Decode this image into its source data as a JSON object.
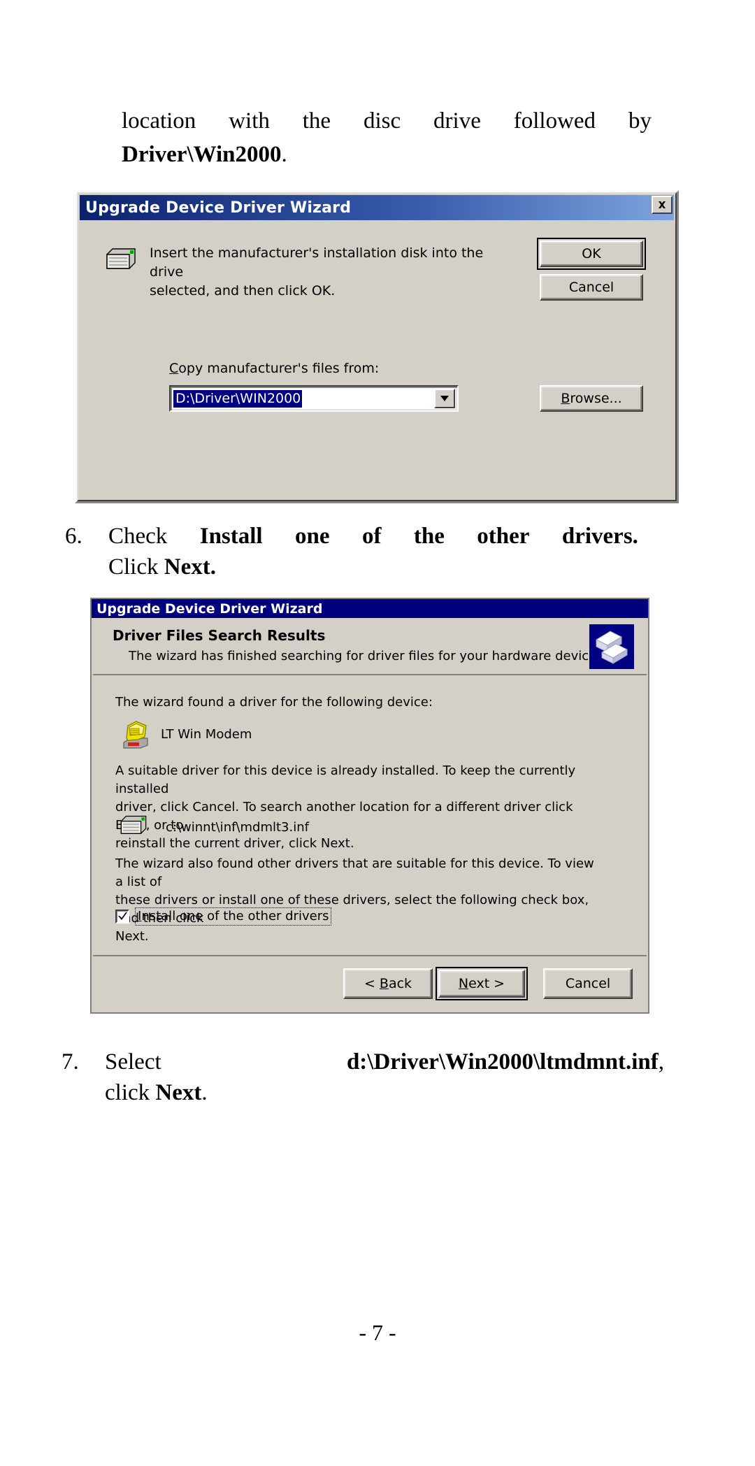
{
  "document": {
    "paragraph_continuation": {
      "line1_words": [
        "location",
        "with",
        "the",
        "disc",
        "drive",
        "followed",
        "by"
      ],
      "line2_bold": "Driver\\Win2000",
      "line2_period": "."
    },
    "step6": {
      "number": "6.",
      "line1_words": [
        "Check",
        "Install",
        "one",
        "of",
        "the",
        "other",
        "drivers."
      ],
      "line2_prefix": "Click ",
      "line2_bold": "Next."
    },
    "step7": {
      "number": "7.",
      "line1_prefix": "Select",
      "line1_bold": "d:\\Driver\\Win2000\\ltmdmnt.inf",
      "line1_suffix": ",",
      "line2_prefix": "click ",
      "line2_bold": "Next",
      "line2_suffix": "."
    },
    "page_number": "- 7 -"
  },
  "dialog1": {
    "title": "Upgrade Device Driver Wizard",
    "close_label": "✕",
    "message_line1": "Insert the manufacturer's installation disk into the drive",
    "message_line2": "selected, and then click OK.",
    "ok_label": "OK",
    "cancel_label": "Cancel",
    "copy_label_accesskey": "C",
    "copy_label_rest": "opy manufacturer's files from:",
    "path_value": "D:\\Driver\\WIN2000",
    "browse_accesskey": "B",
    "browse_rest": "rowse...",
    "icons": {
      "drive": "floppy-drive-icon",
      "dropdown": "chevron-down-icon",
      "close": "close-icon"
    }
  },
  "dialog2": {
    "title": "Upgrade Device Driver Wizard",
    "header_title": "Driver Files Search Results",
    "header_subtitle": "The wizard has finished searching for driver files for your hardware device.",
    "found_label": "The wizard found a driver for the following device:",
    "device_name": "LT Win Modem",
    "paragraph_line1": "A suitable driver for this device is already installed. To keep the currently installed",
    "paragraph_line2": "driver, click Cancel. To search another location for a different driver click Back, or to",
    "paragraph_line3": "reinstall the current driver, click Next.",
    "inf_path": "c:\\winnt\\inf\\mdmlt3.inf",
    "paragraph2_line1": "The wizard also found other drivers that are suitable for this device. To view a list of",
    "paragraph2_line2": "these drivers or install one of these drivers, select the following check box, and then click",
    "paragraph2_line3": "Next.",
    "checkbox": {
      "checked": true,
      "accesskey": "I",
      "label_rest": "nstall one of the other drivers"
    },
    "back_prefix": "< ",
    "back_accesskey": "B",
    "back_rest": "ack",
    "next_accesskey": "N",
    "next_rest": "ext >",
    "cancel_label": "Cancel",
    "icons": {
      "wizard": "driver-chip-icon",
      "modem": "modem-phone-icon",
      "file": "inf-file-icon",
      "check": "checkmark-icon"
    }
  },
  "colors": {
    "dialog_face": "#d4d0c8",
    "title_blue_dark": "#0a246a",
    "title_blue_light": "#7fa4dd",
    "title_solid": "#00007e",
    "selection_blue": "#000080",
    "modem_yellow": "#e8e000"
  }
}
